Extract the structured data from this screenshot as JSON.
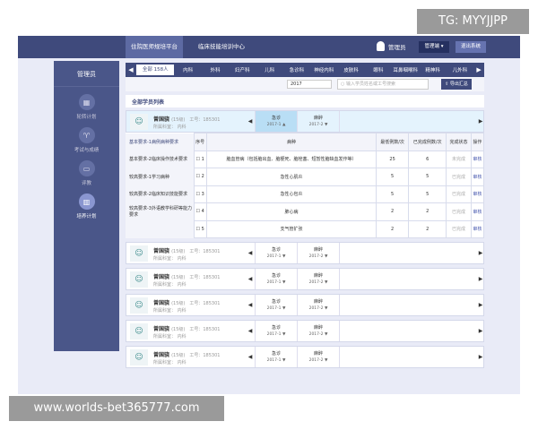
{
  "header": {
    "tabs": [
      "住院医师规培平台",
      "临床技能培训中心"
    ],
    "user": "管理员",
    "role": "管理端 ▾",
    "logout": "退出系统"
  },
  "sidebar": {
    "title": "管理员",
    "items": [
      {
        "label": "轮转计划",
        "icon": "calendar-icon"
      },
      {
        "label": "考试与成绩",
        "icon": "trophy-icon"
      },
      {
        "label": "评教",
        "icon": "chat-icon"
      },
      {
        "label": "培养计划",
        "icon": "book-icon"
      }
    ]
  },
  "departments": [
    "全部 158人",
    "内科",
    "外科",
    "妇产科",
    "儿科",
    "急诊科",
    "神经内科",
    "皮肤科",
    "眼科",
    "耳鼻咽喉科",
    "精神科",
    "儿外科"
  ],
  "filter": {
    "year": "2017",
    "search_placeholder": "输入学员姓名或工号搜索",
    "export": "导出汇总"
  },
  "list_title": "全部学员列表",
  "student": {
    "name": "曾国骁",
    "grade": "(15级)",
    "id": "工号：185301",
    "dept": "所属科室： 内科",
    "rotations": [
      {
        "name": "急诊",
        "date": "2017-1"
      },
      {
        "name": "麻醉",
        "date": "2017-2"
      }
    ]
  },
  "requirements": [
    "基本要求-1病例病种要求",
    "基本要求-2临床操作技术要求",
    "较高要求-1学习病种",
    "较高要求-2临床知识技能要求",
    "较高要求-3外语教学科研等能力要求"
  ],
  "table": {
    "headers": [
      "序号",
      "病种",
      "最低例数/次",
      "已完成例数/次",
      "完成状态",
      "操作"
    ],
    "rows": [
      [
        "1",
        "脑血管病（包括脑出血、脑梗死、脑栓塞、短暂性脑缺血发作等）",
        "25",
        "6",
        "未完成",
        "审核"
      ],
      [
        "2",
        "急性心肌炎",
        "5",
        "5",
        "已完成",
        "审核"
      ],
      [
        "3",
        "急性心包炎",
        "5",
        "5",
        "已完成",
        "审核"
      ],
      [
        "4",
        "肺心病",
        "2",
        "2",
        "已完成",
        "审核"
      ],
      [
        "5",
        "支气管扩张",
        "2",
        "2",
        "已完成",
        "审核"
      ]
    ]
  },
  "watermarks": [
    "TG: MYYJJPP",
    "www.worlds-bet365777.com"
  ]
}
